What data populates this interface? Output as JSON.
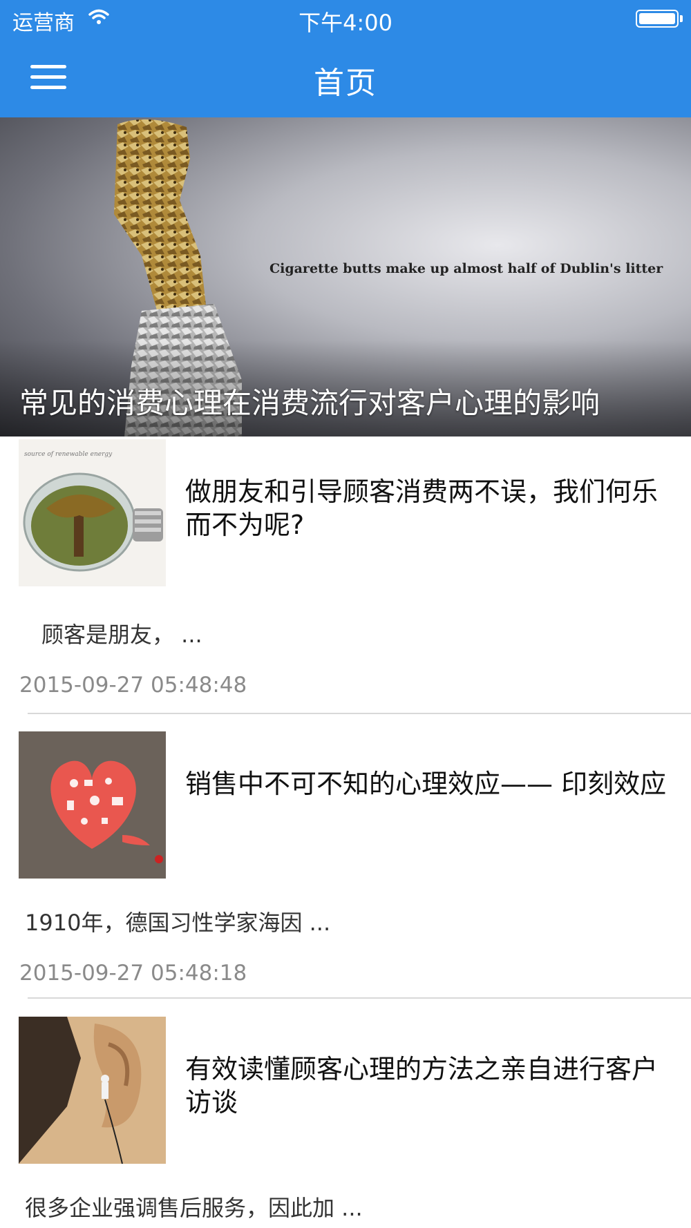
{
  "status_bar": {
    "carrier": "运营商",
    "time": "下午4:00"
  },
  "nav": {
    "title": "首页",
    "menu_icon": "hamburger-menu-icon"
  },
  "hero": {
    "image_caption": "Cigarette butts make up almost half of Dublin's litter",
    "title": "常见的消费心理在消费流行对客户心理的影响"
  },
  "articles": [
    {
      "title": "做朋友和引导顾客消费两不误，我们何乐而不为呢?",
      "summary": "顾客是朋友， ...",
      "date": "2015-09-27 05:48:48",
      "thumb_caption": "source of renewable energy"
    },
    {
      "title": "销售中不可不知的心理效应—— 印刻效应",
      "summary": "1910年，德国习性学家海因 ...",
      "date": "2015-09-27 05:48:18"
    },
    {
      "title": "有效读懂顾客心理的方法之亲自进行客户访谈",
      "summary": "很多企业强调售后服务，因此加 ..."
    }
  ],
  "colors": {
    "header": "#2d8ae6",
    "date_text": "#8a8a8a",
    "divider": "#d8d8d8"
  }
}
